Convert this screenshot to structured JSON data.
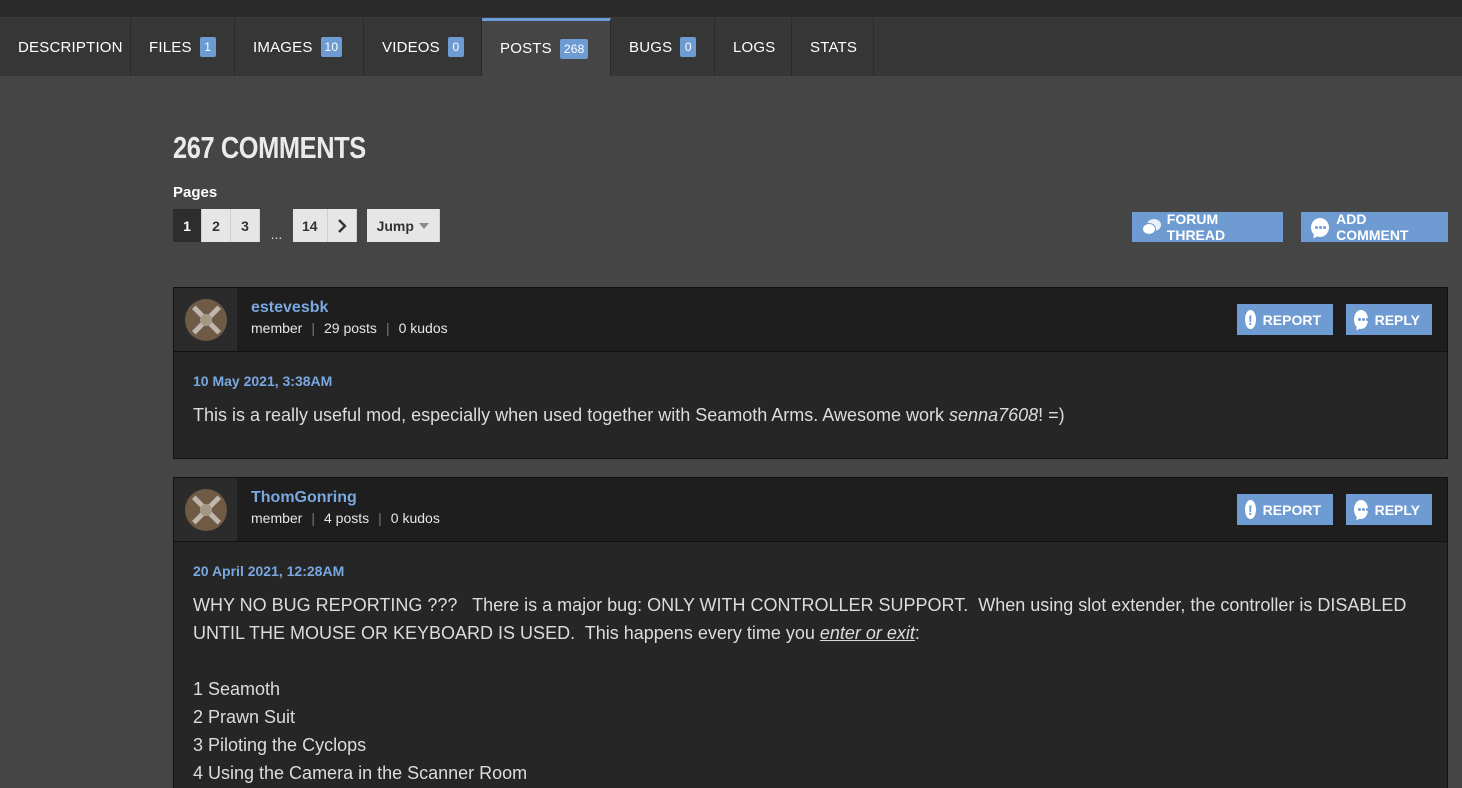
{
  "tabs": [
    {
      "label": "DESCRIPTION",
      "count": ""
    },
    {
      "label": "FILES",
      "count": "1"
    },
    {
      "label": "IMAGES",
      "count": "10"
    },
    {
      "label": "VIDEOS",
      "count": "0"
    },
    {
      "label": "POSTS",
      "count": "268"
    },
    {
      "label": "BUGS",
      "count": "0"
    },
    {
      "label": "LOGS",
      "count": ""
    },
    {
      "label": "STATS",
      "count": ""
    }
  ],
  "active_tab": "POSTS",
  "section_title": "267 COMMENTS",
  "pages_label": "Pages",
  "pager": {
    "p1": "1",
    "p2": "2",
    "p3": "3",
    "ellipsis": "...",
    "last": "14",
    "next": ">",
    "jump": "Jump"
  },
  "actions": {
    "forum_thread": "FORUM THREAD",
    "add_comment": "ADD COMMENT"
  },
  "comments": [
    {
      "author": "estevesbk",
      "role": "member",
      "posts": "29 posts",
      "kudos": "0 kudos",
      "report": "REPORT",
      "reply": "REPLY",
      "date": "10 May 2021, 3:38AM",
      "text_a": "This is a really useful mod, especially when used together with Seamoth Arms. Awesome work ",
      "text_em": "senna7608",
      "text_b": "! =)"
    },
    {
      "author": "ThomGonring",
      "role": "member",
      "posts": "4 posts",
      "kudos": "0 kudos",
      "report": "REPORT",
      "reply": "REPLY",
      "date": "20 April 2021, 12:28AM",
      "line1": "WHY NO BUG REPORTING ???   There is a major bug: ONLY WITH CONTROLLER SUPPORT.  When using slot extender, the controller is DISABLED",
      "line2_a": "UNTIL THE MOUSE OR KEYBOARD IS USED.  This happens every time you ",
      "line2_em": "enter or exit",
      "line2_b": ":",
      "list": [
        "1 Seamoth",
        "2 Prawn Suit",
        "3 Piloting the Cyclops",
        "4 Using the Camera in the Scanner Room"
      ]
    }
  ]
}
